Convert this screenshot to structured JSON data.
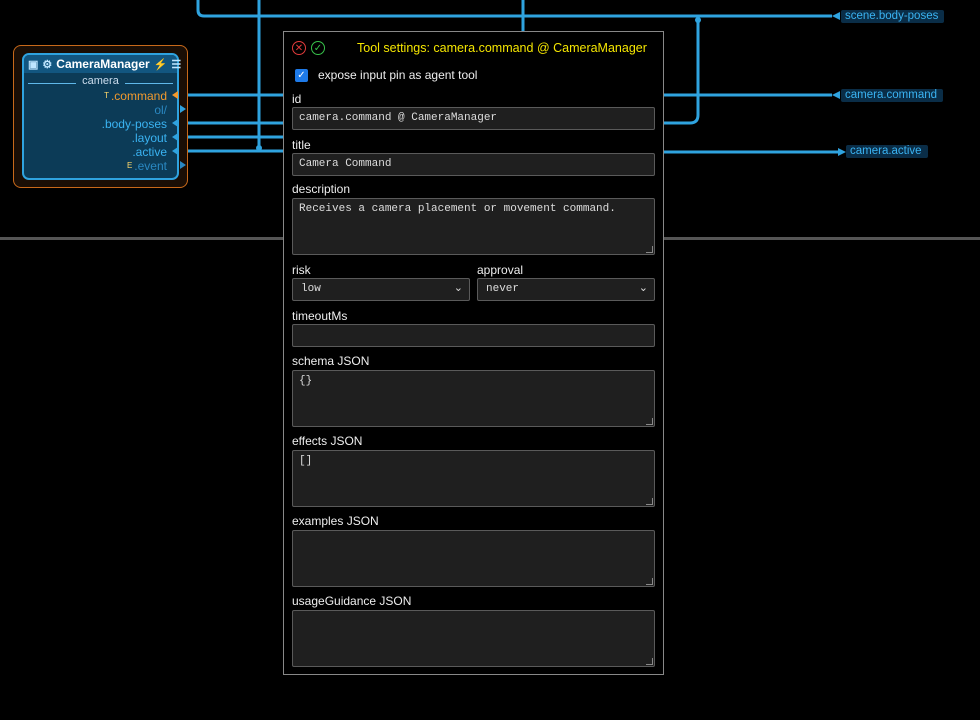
{
  "node": {
    "title": "CameraManager",
    "section": "camera",
    "pins": [
      {
        "label": ".command",
        "prefix": "T"
      },
      {
        "label": "ol/",
        "prefix": ""
      },
      {
        "label": ".body-poses",
        "prefix": ""
      },
      {
        "label": ".layout",
        "prefix": ""
      },
      {
        "label": ".active",
        "prefix": ""
      },
      {
        "label": ".event",
        "prefix": "E"
      }
    ]
  },
  "right_tags": {
    "top": "scene.body-poses",
    "command": "camera.command",
    "active": "camera.active"
  },
  "dialog": {
    "title": "Tool settings: camera.command @ CameraManager",
    "expose_label": "expose input pin as agent tool",
    "expose_checked": true,
    "labels": {
      "id": "id",
      "title": "title",
      "description": "description",
      "risk": "risk",
      "approval": "approval",
      "timeout": "timeoutMs",
      "schema": "schema JSON",
      "effects": "effects JSON",
      "examples": "examples JSON",
      "usage": "usageGuidance JSON"
    },
    "values": {
      "id": "camera.command @ CameraManager",
      "title": "Camera Command",
      "description": "Receives a camera placement or movement command.",
      "risk": "low",
      "approval": "never",
      "timeout": "",
      "schema": "{}",
      "effects": "[]",
      "examples": "",
      "usage": ""
    }
  },
  "colors": {
    "wire": "#2fa3df",
    "command_pin": "#f29a2e",
    "dialog_title": "#f5e600"
  }
}
